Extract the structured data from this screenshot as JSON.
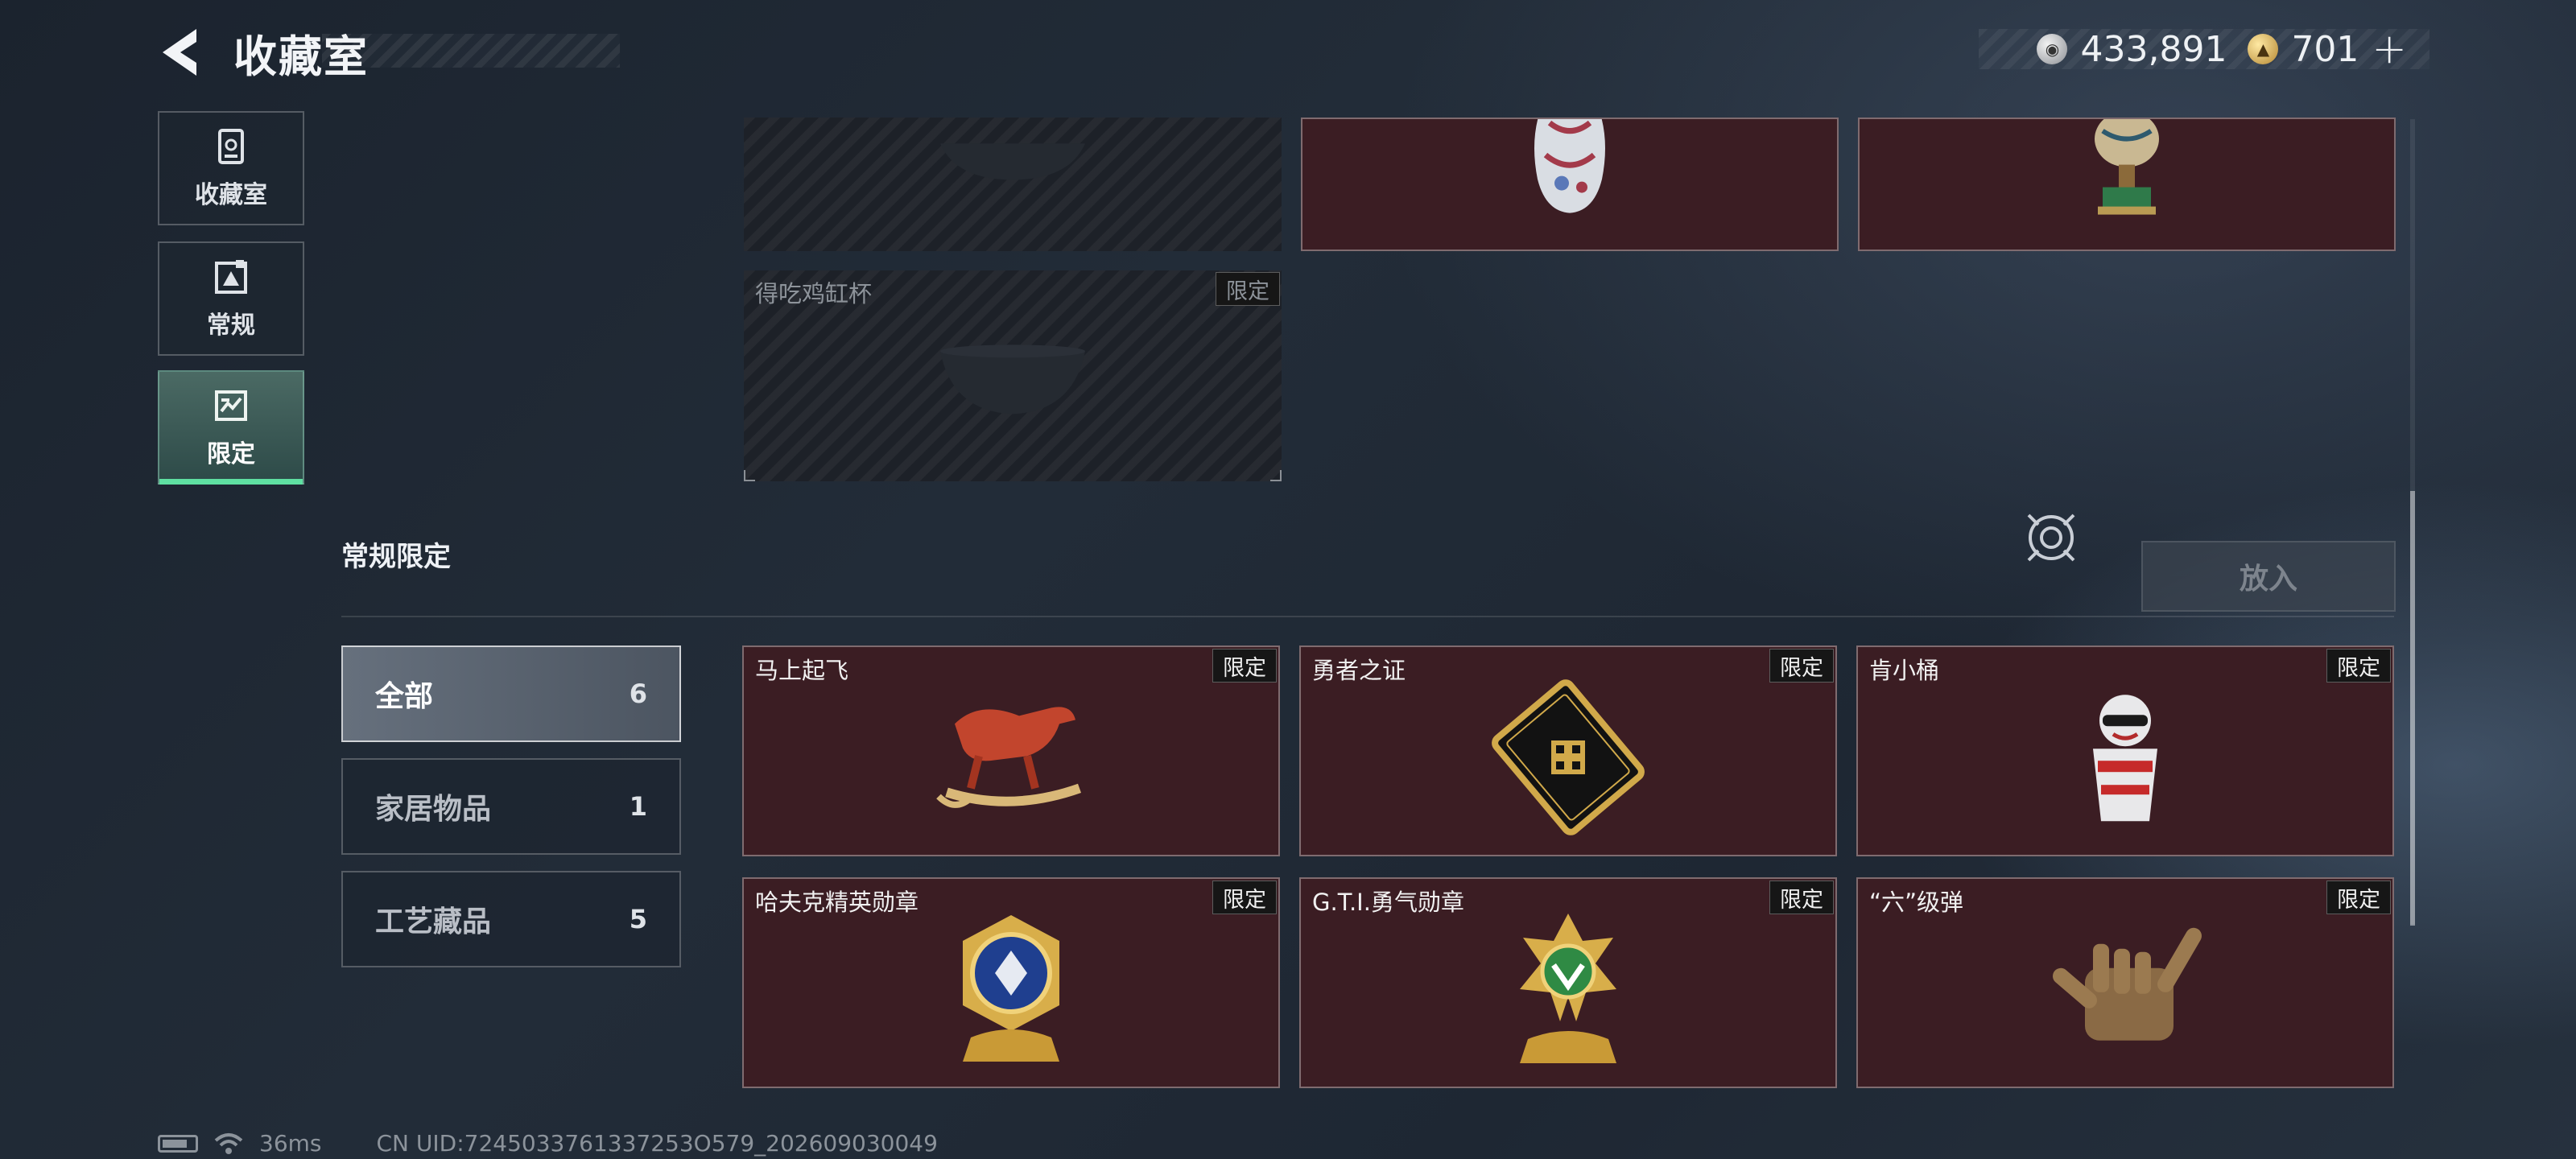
{
  "header": {
    "title": "收藏室",
    "currency": [
      {
        "icon": "silver-coin-icon",
        "value": "433,891"
      },
      {
        "icon": "gold-coin-icon",
        "value": "701"
      }
    ],
    "plus_label": "+"
  },
  "nav": {
    "items": [
      {
        "label": "收藏室",
        "icon": "trophy-shelf-icon"
      },
      {
        "label": "常规",
        "icon": "picture-card-icon"
      },
      {
        "label": "限定",
        "icon": "limited-collection-icon",
        "active": true
      }
    ]
  },
  "top_grid": {
    "cards": [
      {
        "name": "",
        "tag": "",
        "style": "dark",
        "art": "bowl-silhouette"
      },
      {
        "name": "",
        "tag": "",
        "style": "red",
        "art": "porcelain-vase"
      },
      {
        "name": "",
        "tag": "",
        "style": "red",
        "art": "goose-trophy"
      },
      {
        "name": "得吃鸡缸杯",
        "tag": "限定",
        "style": "dark",
        "art": "chicken-cup-bowl"
      }
    ]
  },
  "section": {
    "title": "常规限定",
    "place_button": "放入",
    "categories": [
      {
        "label": "全部",
        "count": "6",
        "active": true
      },
      {
        "label": "家居物品",
        "count": "1"
      },
      {
        "label": "工艺藏品",
        "count": "5"
      }
    ],
    "items": [
      {
        "name": "马上起飞",
        "tag": "限定",
        "art": "rocking-horse"
      },
      {
        "name": "勇者之证",
        "tag": "限定",
        "art": "gold-card"
      },
      {
        "name": "肯小桶",
        "tag": "限定",
        "art": "bucket-figure"
      },
      {
        "name": "哈夫克精英勋章",
        "tag": "限定",
        "art": "elite-medal"
      },
      {
        "name": "G.T.I.勇气勋章",
        "tag": "限定",
        "art": "courage-medal"
      },
      {
        "name": "“六”级弹",
        "tag": "限定",
        "art": "bullet-hand"
      }
    ]
  },
  "status": {
    "ping": "36ms",
    "uid": "CN UID:7245033761337253O579_202609030049"
  },
  "colors": {
    "accent_green": "#5fe0a2",
    "card_red": "#3b1d23",
    "background": "#1e2733"
  }
}
